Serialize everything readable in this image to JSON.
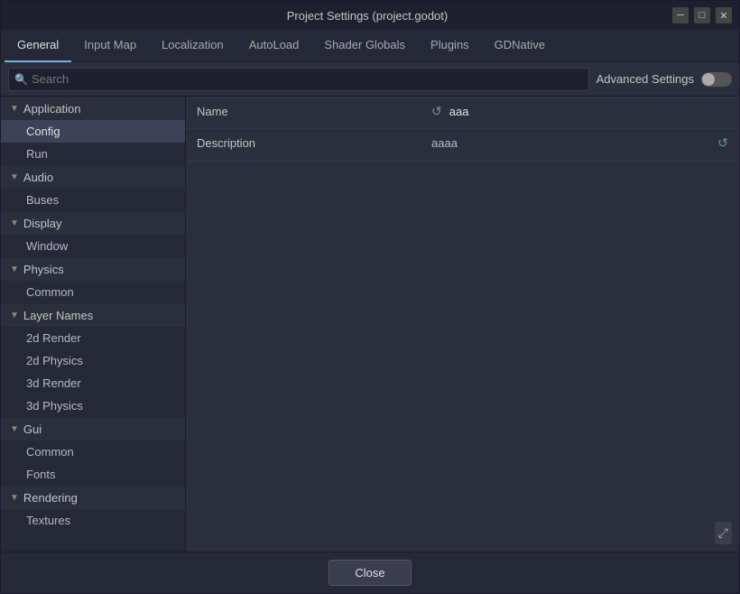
{
  "window": {
    "title": "Project Settings (project.godot)",
    "minimize_label": "─",
    "maximize_label": "□",
    "close_label": "✕"
  },
  "tabs": [
    {
      "label": "General",
      "active": true
    },
    {
      "label": "Input Map",
      "active": false
    },
    {
      "label": "Localization",
      "active": false
    },
    {
      "label": "AutoLoad",
      "active": false
    },
    {
      "label": "Shader Globals",
      "active": false
    },
    {
      "label": "Plugins",
      "active": false
    },
    {
      "label": "GDNative",
      "active": false
    }
  ],
  "toolbar": {
    "search_placeholder": "Search",
    "advanced_settings_label": "Advanced Settings"
  },
  "sidebar": {
    "sections": [
      {
        "id": "application",
        "label": "Application",
        "expanded": true,
        "items": [
          {
            "id": "config",
            "label": "Config",
            "active": true
          },
          {
            "id": "run",
            "label": "Run",
            "active": false
          }
        ]
      },
      {
        "id": "audio",
        "label": "Audio",
        "expanded": true,
        "items": [
          {
            "id": "buses",
            "label": "Buses",
            "active": false
          }
        ]
      },
      {
        "id": "display",
        "label": "Display",
        "expanded": true,
        "items": [
          {
            "id": "window",
            "label": "Window",
            "active": false
          }
        ]
      },
      {
        "id": "physics",
        "label": "Physics",
        "expanded": true,
        "items": [
          {
            "id": "common",
            "label": "Common",
            "active": false
          }
        ]
      },
      {
        "id": "layer-names",
        "label": "Layer Names",
        "expanded": true,
        "items": [
          {
            "id": "2d-render",
            "label": "2d Render",
            "active": false
          },
          {
            "id": "2d-physics",
            "label": "2d Physics",
            "active": false
          },
          {
            "id": "3d-render",
            "label": "3d Render",
            "active": false
          },
          {
            "id": "3d-physics",
            "label": "3d Physics",
            "active": false
          }
        ]
      },
      {
        "id": "gui",
        "label": "Gui",
        "expanded": true,
        "items": [
          {
            "id": "gui-common",
            "label": "Common",
            "active": false
          },
          {
            "id": "fonts",
            "label": "Fonts",
            "active": false
          }
        ]
      },
      {
        "id": "rendering",
        "label": "Rendering",
        "expanded": true,
        "items": [
          {
            "id": "textures",
            "label": "Textures",
            "active": false
          }
        ]
      }
    ]
  },
  "main": {
    "rows": [
      {
        "label": "Name",
        "value": "aaa",
        "has_reset": true,
        "reset_icon": "↺"
      },
      {
        "label": "Description",
        "value": "aaaa",
        "has_reset": true,
        "reset_icon": "↺"
      }
    ]
  },
  "bottom": {
    "close_label": "Close"
  }
}
